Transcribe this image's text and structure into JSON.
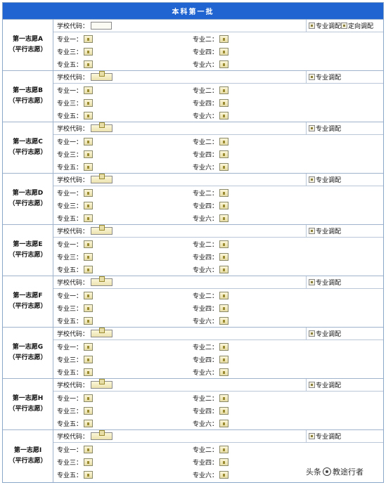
{
  "form": {
    "banner": "本科第一批",
    "code_label": "学校代码：",
    "adjust_label": "专业调配",
    "directed_label": "定向调配",
    "major_labels": [
      "专业一：",
      "专业二：",
      "专业三：",
      "专业四：",
      "专业五：",
      "专业六："
    ],
    "groups": [
      {
        "line1": "第一志愿A",
        "line2": "（平行志愿）"
      },
      {
        "line1": "第一志愿B",
        "line2": "（平行志愿）"
      },
      {
        "line1": "第一志愿C",
        "line2": "（平行志愿）"
      },
      {
        "line1": "第一志愿D",
        "line2": "（平行志愿）"
      },
      {
        "line1": "第一志愿E",
        "line2": "（平行志愿）"
      },
      {
        "line1": "第一志愿F",
        "line2": "（平行志愿）"
      },
      {
        "line1": "第一志愿G",
        "line2": "（平行志愿）"
      },
      {
        "line1": "第一志愿H",
        "line2": "（平行志愿）"
      },
      {
        "line1": "第一志愿I",
        "line2": "（平行志愿）"
      }
    ]
  },
  "watermark": {
    "prefix": "头条",
    "handle": "教途行者"
  }
}
